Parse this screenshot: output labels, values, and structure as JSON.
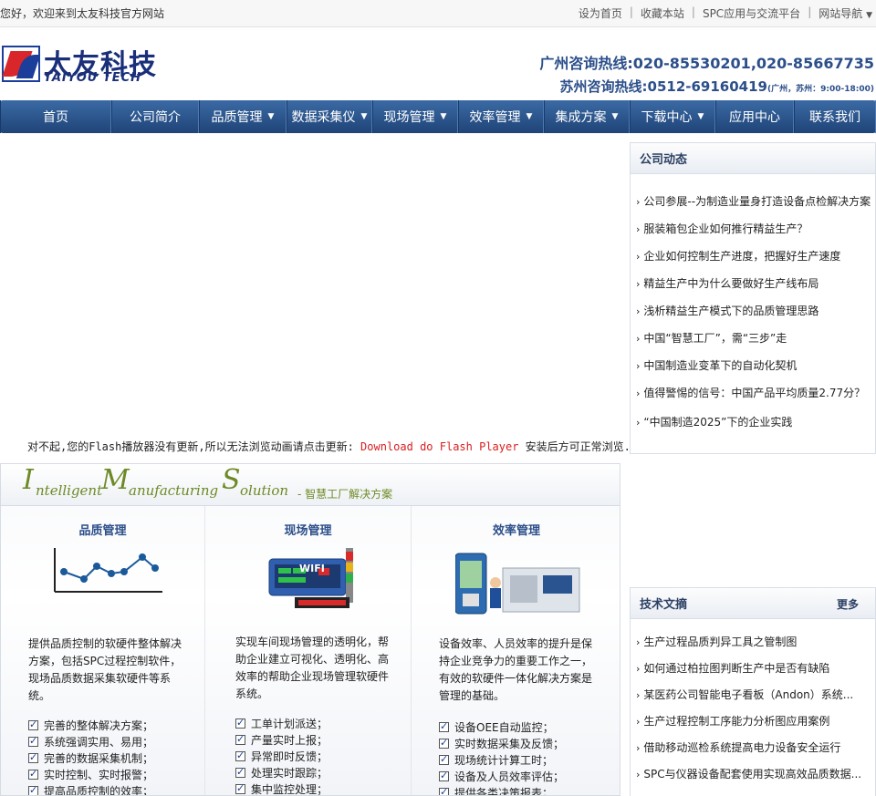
{
  "topbar": {
    "welcome": "您好，欢迎来到太友科技官方网站",
    "links": [
      "设为首页",
      "收藏本站",
      "SPC应用与交流平台",
      "网站导航"
    ]
  },
  "header": {
    "logo_cn": "太友科技",
    "logo_en": "TAIYOU TECH",
    "hotline1": "广州咨询热线:020-85530201,020-85667735",
    "hotline2": "苏州咨询热线:0512-69160419",
    "hotline2_note": "(广州，苏州：9:00-18:00)"
  },
  "nav": [
    {
      "label": "首页",
      "caret": false
    },
    {
      "label": "公司简介",
      "caret": false
    },
    {
      "label": "品质管理",
      "caret": true
    },
    {
      "label": "数据采集仪",
      "caret": true
    },
    {
      "label": "现场管理",
      "caret": true
    },
    {
      "label": "效率管理",
      "caret": true
    },
    {
      "label": "集成方案",
      "caret": true
    },
    {
      "label": "下载中心",
      "caret": true
    },
    {
      "label": "应用中心",
      "caret": false
    },
    {
      "label": "联系我们",
      "caret": false
    }
  ],
  "flash": {
    "prefix": "对不起,您的Flash播放器没有更新,所以无法浏览动画请点击更新:",
    "link": "Download do Flash Player",
    "suffix": "安装后方可正常浏览."
  },
  "news": {
    "title": "公司动态",
    "items": [
      "公司参展--为制造业量身打造设备点检解决方案",
      "服装箱包企业如何推行精益生产？",
      "企业如何控制生产进度，把握好生产速度",
      "精益生产中为什么要做好生产线布局",
      "浅析精益生产模式下的品质管理思路",
      "中国“智慧工厂”，需“三步”走",
      "中国制造业变革下的自动化契机",
      "值得警惕的信号：中国产品平均质量2.77分？",
      "“中国制造2025”下的企业实践"
    ]
  },
  "articles": {
    "title": "技术文摘",
    "more": "更多",
    "items": [
      "生产过程品质判异工具之管制图",
      "如何通过柏拉图判断生产中是否有缺陷",
      "某医药公司智能电子看板（Andon）系统...",
      "生产过程控制工序能力分析图应用案例",
      "借助移动巡检系统提高电力设备安全运行",
      "SPC与仪器设备配套使用实现高效品质数据..."
    ]
  },
  "ims": {
    "title_i": "I",
    "title_rest1": "ntelligent ",
    "title_m": "M",
    "title_rest2": "anufacturing ",
    "title_s": "S",
    "title_rest3": "olution",
    "subtitle": "- 智慧工厂解决方案",
    "columns": [
      {
        "title": "品质管理",
        "desc": "提供品质控制的软硬件整体解决方案，包括SPC过程控制软件，现场品质数据采集软硬件等系统。",
        "features": [
          "完善的整体解决方案；",
          "系统强调实用、易用；",
          "完善的数据采集机制；",
          "实时控制、实时报警；",
          "提高品质控制的效率；"
        ]
      },
      {
        "title": "现场管理",
        "image_label": "WIFI",
        "desc": "实现车间现场管理的透明化，帮助企业建立可视化、透明化、高效率的帮助企业现场管理软硬件系统。",
        "features": [
          "工单计划派送；",
          "产量实时上报；",
          "异常即时反馈；",
          "处理实时跟踪；",
          "集中监控处理；"
        ]
      },
      {
        "title": "效率管理",
        "desc": "设备效率、人员效率的提升是保持企业竞争力的重要工作之一，有效的软硬件一体化解决方案是管理的基础。",
        "features": [
          "设备OEE自动监控；",
          "实时数据采集及反馈；",
          "现场统计计算工时；",
          "设备及人员效率评估；",
          "提供各类决策报表；"
        ]
      }
    ]
  },
  "colors": {
    "nav_bg": "#2a5490",
    "accent_blue": "#2c4f8a",
    "accent_green": "#6e8a26",
    "link_red": "#d92020"
  }
}
